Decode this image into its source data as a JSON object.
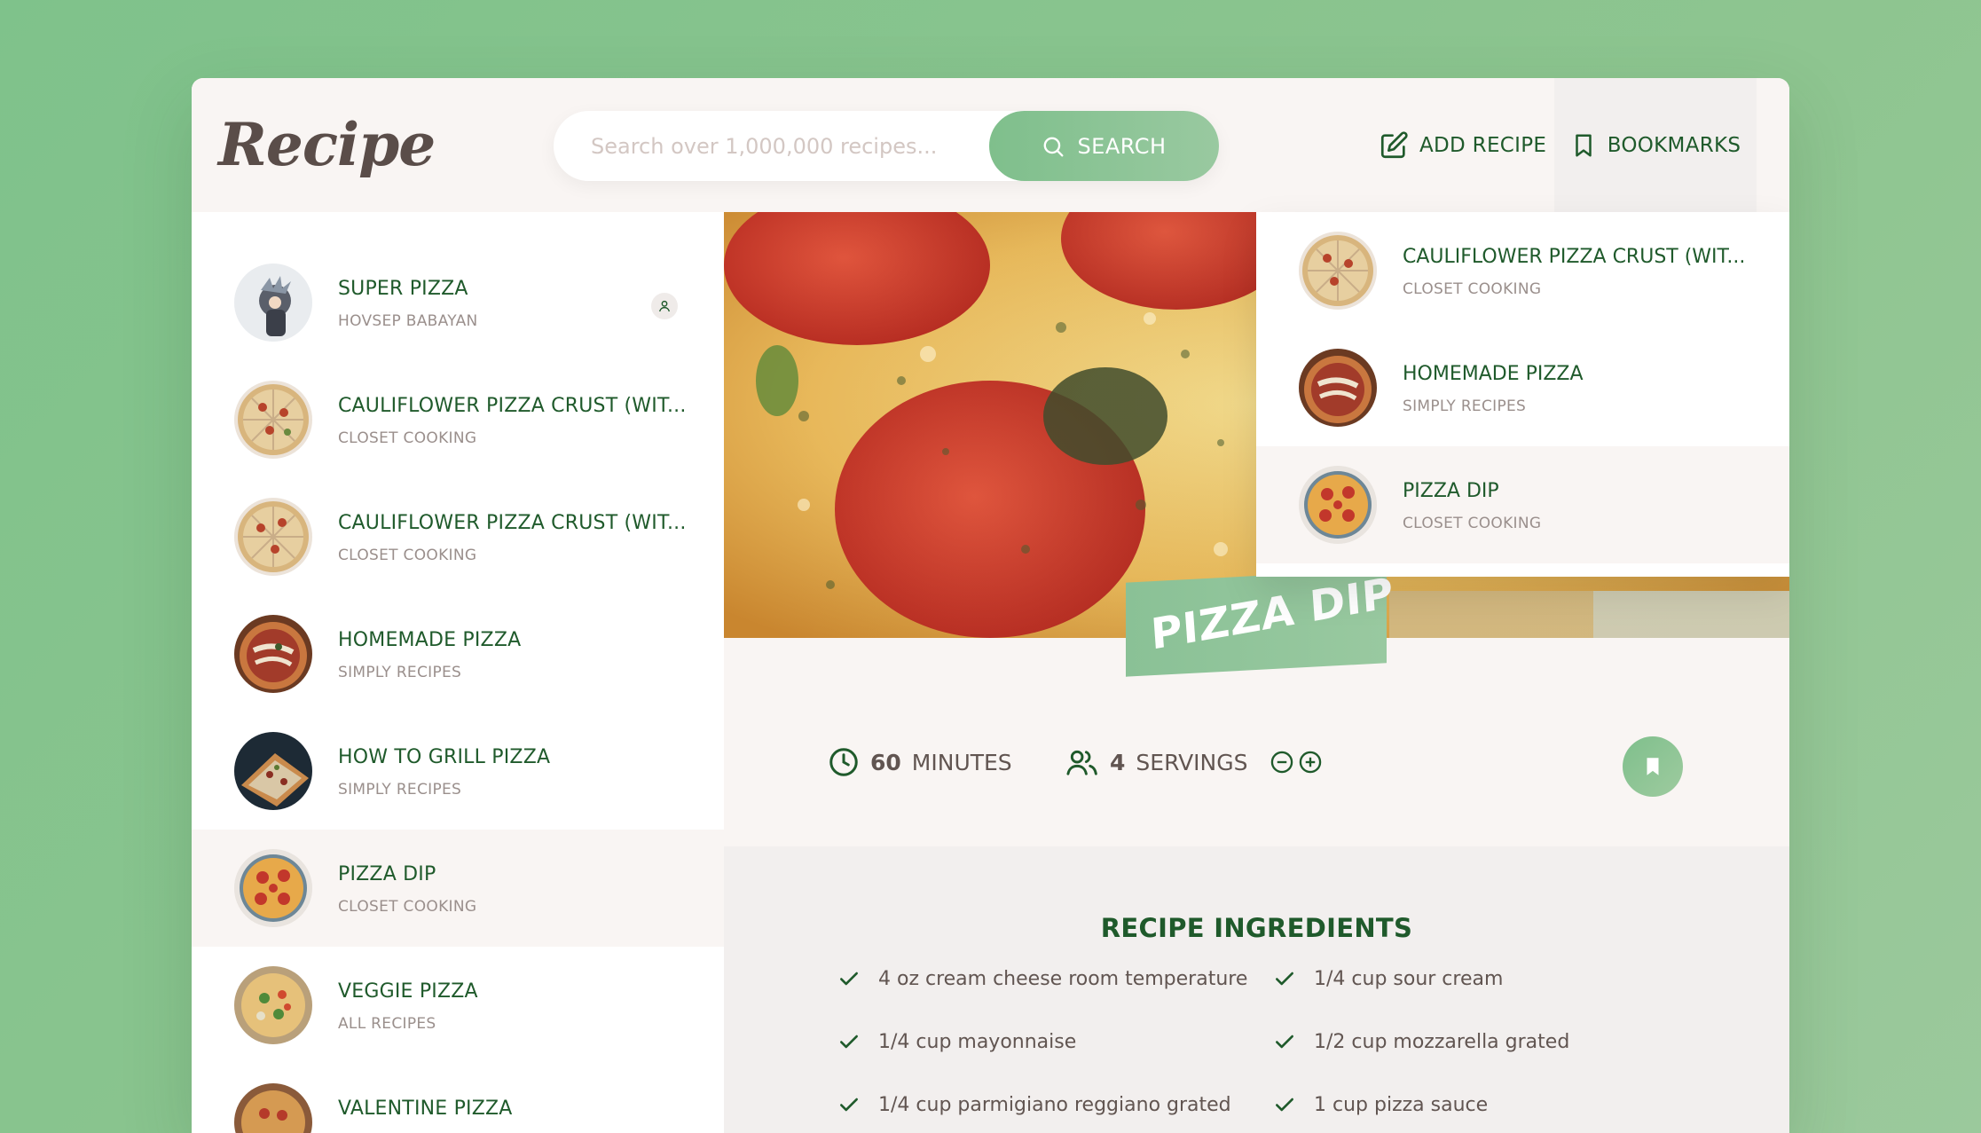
{
  "header": {
    "logo": "Recipe",
    "search_placeholder": "Search over 1,000,000 recipes...",
    "search_button": "SEARCH",
    "add_recipe": "ADD RECIPE",
    "bookmarks": "BOOKMARKS"
  },
  "results": [
    {
      "title": "SUPER PIZZA",
      "publisher": "HOVSEP BABAYAN",
      "user_generated": true,
      "active": false
    },
    {
      "title": "CAULIFLOWER PIZZA CRUST (WIT...",
      "publisher": "CLOSET COOKING",
      "active": false
    },
    {
      "title": "CAULIFLOWER PIZZA CRUST (WIT...",
      "publisher": "CLOSET COOKING",
      "active": false
    },
    {
      "title": "HOMEMADE PIZZA",
      "publisher": "SIMPLY RECIPES",
      "active": false
    },
    {
      "title": "HOW TO GRILL PIZZA",
      "publisher": "SIMPLY RECIPES",
      "active": false
    },
    {
      "title": "PIZZA DIP",
      "publisher": "CLOSET COOKING",
      "active": true
    },
    {
      "title": "VEGGIE PIZZA",
      "publisher": "ALL RECIPES",
      "active": false
    },
    {
      "title": "VALENTINE PIZZA",
      "publisher": "",
      "active": false
    }
  ],
  "bookmarks_list": [
    {
      "title": "CAULIFLOWER PIZZA CRUST (WIT...",
      "publisher": "CLOSET COOKING",
      "active": false
    },
    {
      "title": "HOMEMADE PIZZA",
      "publisher": "SIMPLY RECIPES",
      "active": false
    },
    {
      "title": "PIZZA DIP",
      "publisher": "CLOSET COOKING",
      "active": true
    }
  ],
  "recipe": {
    "title": "PIZZA DIP",
    "cooking_time": "60",
    "time_unit": "MINUTES",
    "servings": "4",
    "servings_unit": "SERVINGS",
    "ingredients_title": "RECIPE INGREDIENTS",
    "ingredients": [
      "4 oz cream cheese room temperature",
      "1/4 cup sour cream",
      "1/4 cup mayonnaise",
      "1/2 cup mozzarella grated",
      "1/4 cup parmigiano reggiano grated",
      "1 cup pizza sauce"
    ]
  },
  "colors": {
    "accent": "#7fbf8c",
    "title_green": "#1f5a2b",
    "bg": "#f9f5f3",
    "text": "#615551"
  }
}
